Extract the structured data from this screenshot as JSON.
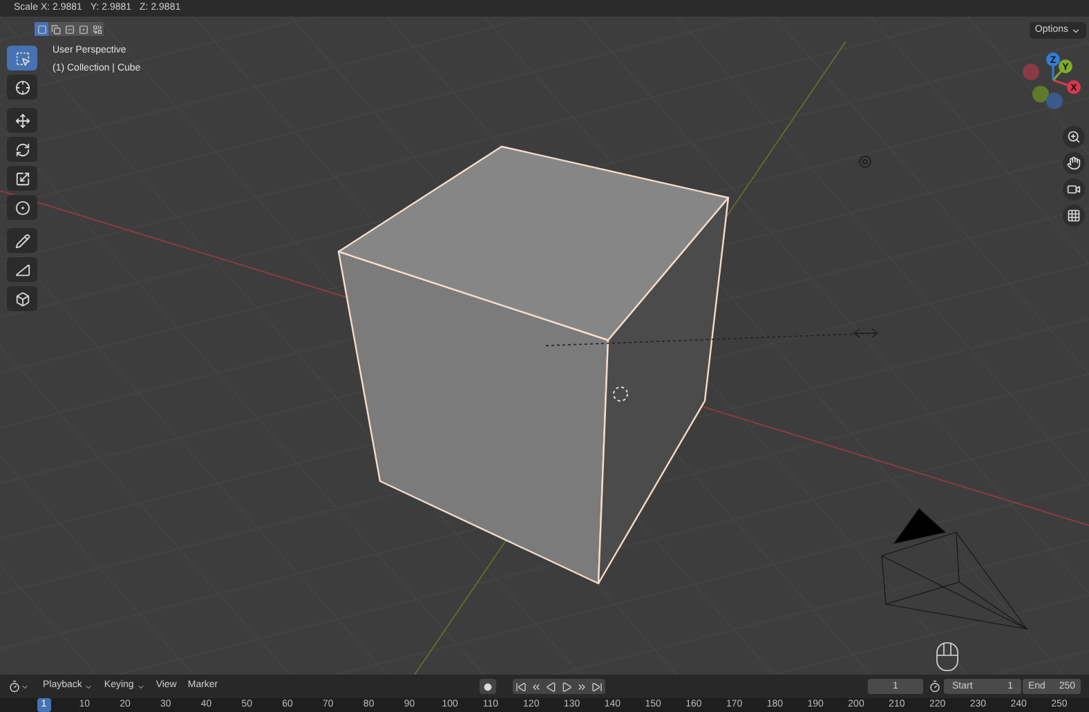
{
  "header": {
    "status": [
      "Scale X: 2.9881",
      "Y: 2.9881",
      "Z: 2.9881"
    ]
  },
  "select_modes": [
    {
      "kind": "new",
      "selected": true
    },
    {
      "kind": "extend",
      "selected": false
    },
    {
      "kind": "subtract",
      "selected": false
    },
    {
      "kind": "invert",
      "selected": false
    },
    {
      "kind": "intersect",
      "selected": false
    }
  ],
  "options": {
    "label": "Options"
  },
  "viewport": {
    "view_name": "User Perspective",
    "object_info": "(1) Collection | Cube"
  },
  "tools": [
    {
      "kind": "select",
      "selected": true
    },
    {
      "kind": "cursor",
      "selected": false
    },
    {
      "kind": "move",
      "selected": false
    },
    {
      "kind": "rotate",
      "selected": false
    },
    {
      "kind": "scale",
      "selected": false
    },
    {
      "kind": "transform",
      "selected": false
    },
    {
      "kind": "annotate",
      "selected": false
    },
    {
      "kind": "measure",
      "selected": false
    },
    {
      "kind": "add-cube",
      "selected": false
    }
  ],
  "gizmo_axes": [
    {
      "kind": "negative",
      "color": "#8a3a44"
    },
    {
      "kind": "negative",
      "color": "#5f7a2c"
    },
    {
      "kind": "negative",
      "color": "#3a5a8a"
    },
    {
      "kind": "positive",
      "label": "X",
      "color": "#d9384f"
    },
    {
      "kind": "positive",
      "label": "Y",
      "color": "#7fab2a"
    },
    {
      "kind": "positive",
      "label": "Z",
      "color": "#2f7fd6"
    }
  ],
  "nav_buttons": [
    {
      "kind": "zoom"
    },
    {
      "kind": "pan"
    },
    {
      "kind": "camera"
    },
    {
      "kind": "ortho"
    }
  ],
  "timeline": {
    "menus": [
      {
        "label": "Playback",
        "dropdown": true
      },
      {
        "label": "Keying",
        "dropdown": true
      },
      {
        "label": "View",
        "dropdown": false
      },
      {
        "label": "Marker",
        "dropdown": false
      }
    ],
    "current_frame": "1",
    "start_label": "Start",
    "start": "1",
    "end_label": "End",
    "end": "250",
    "ruler": [
      {
        "label": "1",
        "selected": true
      },
      {
        "label": "10",
        "selected": false
      },
      {
        "label": "20",
        "selected": false
      },
      {
        "label": "30",
        "selected": false
      },
      {
        "label": "40",
        "selected": false
      },
      {
        "label": "50",
        "selected": false
      },
      {
        "label": "60",
        "selected": false
      },
      {
        "label": "70",
        "selected": false
      },
      {
        "label": "80",
        "selected": false
      },
      {
        "label": "90",
        "selected": false
      },
      {
        "label": "100",
        "selected": false
      },
      {
        "label": "110",
        "selected": false
      },
      {
        "label": "120",
        "selected": false
      },
      {
        "label": "130",
        "selected": false
      },
      {
        "label": "140",
        "selected": false
      },
      {
        "label": "150",
        "selected": false
      },
      {
        "label": "160",
        "selected": false
      },
      {
        "label": "170",
        "selected": false
      },
      {
        "label": "180",
        "selected": false
      },
      {
        "label": "190",
        "selected": false
      },
      {
        "label": "200",
        "selected": false
      },
      {
        "label": "210",
        "selected": false
      },
      {
        "label": "220",
        "selected": false
      },
      {
        "label": "230",
        "selected": false
      },
      {
        "label": "240",
        "selected": false
      },
      {
        "label": "250",
        "selected": false
      }
    ]
  }
}
